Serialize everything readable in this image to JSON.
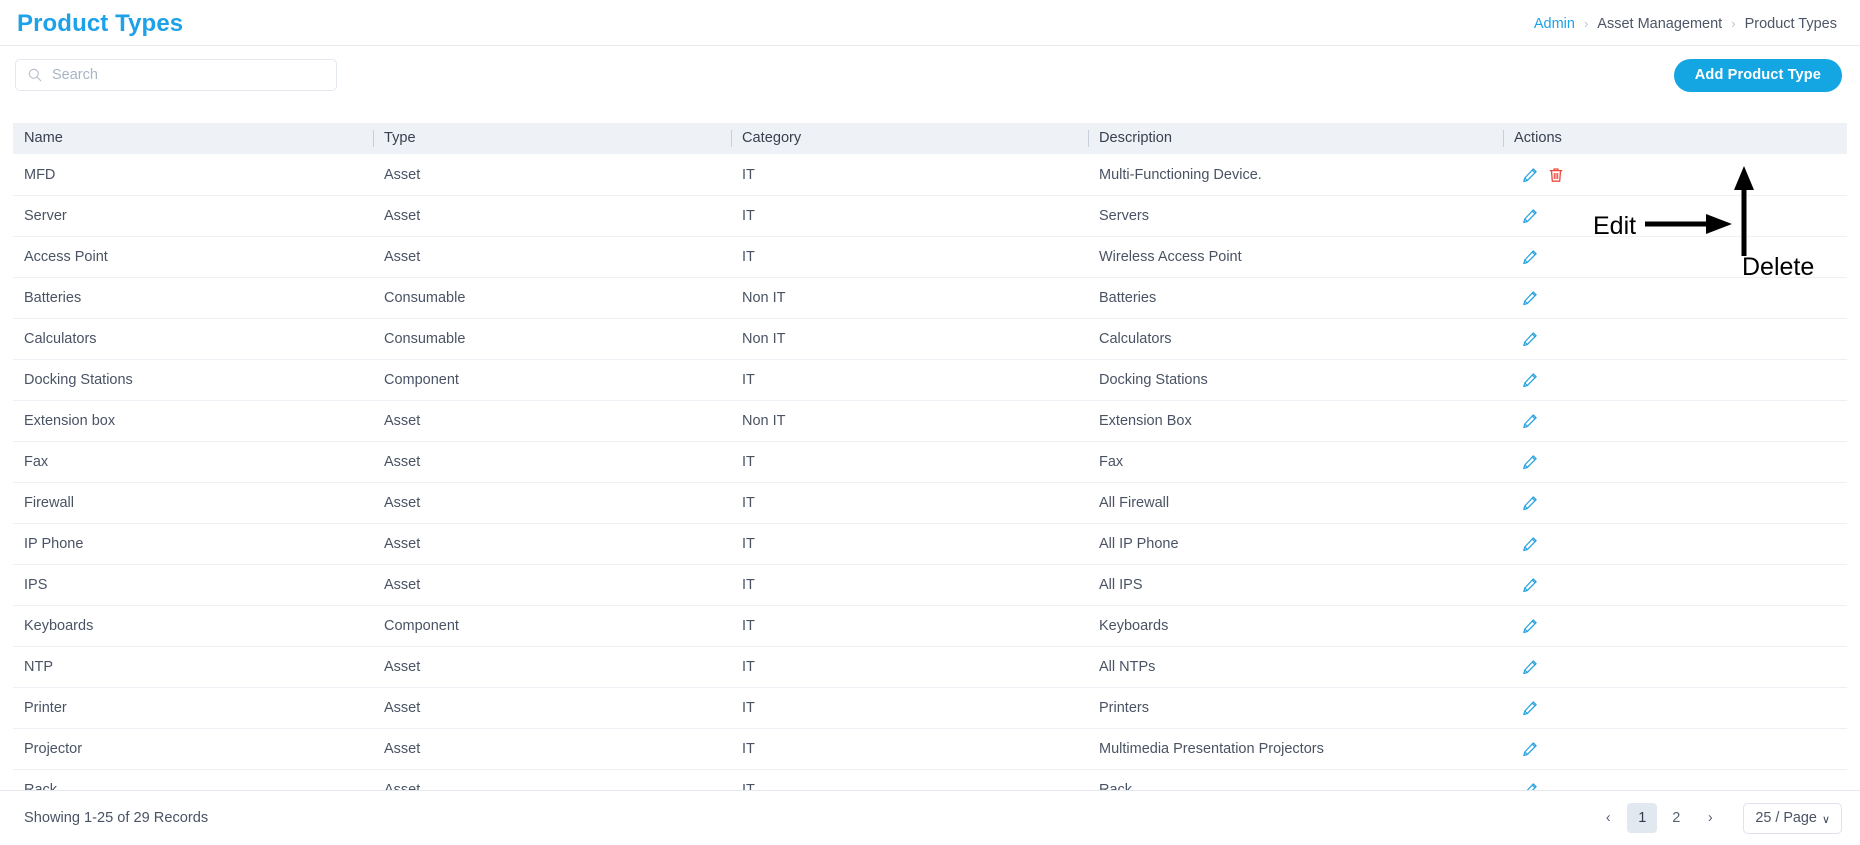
{
  "header": {
    "title": "Product Types",
    "breadcrumb": [
      {
        "label": "Admin",
        "link": true
      },
      {
        "label": "Asset Management",
        "link": false
      },
      {
        "label": "Product Types",
        "link": false
      }
    ],
    "separator": "›"
  },
  "toolbar": {
    "search_placeholder": "Search",
    "search_value": "",
    "search_icon": "search-icon",
    "add_label": "Add Product Type",
    "accent_color": "#14a5e3"
  },
  "table": {
    "columns": [
      "Name",
      "Type",
      "Category",
      "Description",
      "Actions"
    ],
    "edit_icon": "pencil-icon",
    "delete_icon": "trash-icon",
    "edit_icon_color": "#29a3e0",
    "delete_icon_color": "#f0493e",
    "rows": [
      {
        "name": "MFD",
        "type": "Asset",
        "category": "IT",
        "description": "Multi-Functioning Device.",
        "edit": true,
        "delete": true
      },
      {
        "name": "Server",
        "type": "Asset",
        "category": "IT",
        "description": "Servers",
        "edit": true,
        "delete": false
      },
      {
        "name": "Access Point",
        "type": "Asset",
        "category": "IT",
        "description": "Wireless Access Point",
        "edit": true,
        "delete": false
      },
      {
        "name": "Batteries",
        "type": "Consumable",
        "category": "Non IT",
        "description": "Batteries",
        "edit": true,
        "delete": false
      },
      {
        "name": "Calculators",
        "type": "Consumable",
        "category": "Non IT",
        "description": "Calculators",
        "edit": true,
        "delete": false
      },
      {
        "name": "Docking Stations",
        "type": "Component",
        "category": "IT",
        "description": "Docking Stations",
        "edit": true,
        "delete": false
      },
      {
        "name": "Extension box",
        "type": "Asset",
        "category": "Non IT",
        "description": "Extension Box",
        "edit": true,
        "delete": false
      },
      {
        "name": "Fax",
        "type": "Asset",
        "category": "IT",
        "description": "Fax",
        "edit": true,
        "delete": false
      },
      {
        "name": "Firewall",
        "type": "Asset",
        "category": "IT",
        "description": "All Firewall",
        "edit": true,
        "delete": false
      },
      {
        "name": "IP Phone",
        "type": "Asset",
        "category": "IT",
        "description": "All IP Phone",
        "edit": true,
        "delete": false
      },
      {
        "name": "IPS",
        "type": "Asset",
        "category": "IT",
        "description": "All IPS",
        "edit": true,
        "delete": false
      },
      {
        "name": "Keyboards",
        "type": "Component",
        "category": "IT",
        "description": "Keyboards",
        "edit": true,
        "delete": false
      },
      {
        "name": "NTP",
        "type": "Asset",
        "category": "IT",
        "description": "All NTPs",
        "edit": true,
        "delete": false
      },
      {
        "name": "Printer",
        "type": "Asset",
        "category": "IT",
        "description": "Printers",
        "edit": true,
        "delete": false
      },
      {
        "name": "Projector",
        "type": "Asset",
        "category": "IT",
        "description": "Multimedia Presentation Projectors",
        "edit": true,
        "delete": false
      },
      {
        "name": "Rack",
        "type": "Asset",
        "category": "IT",
        "description": "Rack",
        "edit": true,
        "delete": false
      }
    ]
  },
  "footer": {
    "records_text": "Showing 1-25 of 29 Records",
    "prev_label": "‹",
    "next_label": "›",
    "pages": [
      "1",
      "2"
    ],
    "active_page": "1",
    "page_size_label": "25 / Page",
    "caret": "∨"
  },
  "annotations": [
    {
      "id": "edit",
      "label": "Edit"
    },
    {
      "id": "delete",
      "label": "Delete"
    }
  ]
}
